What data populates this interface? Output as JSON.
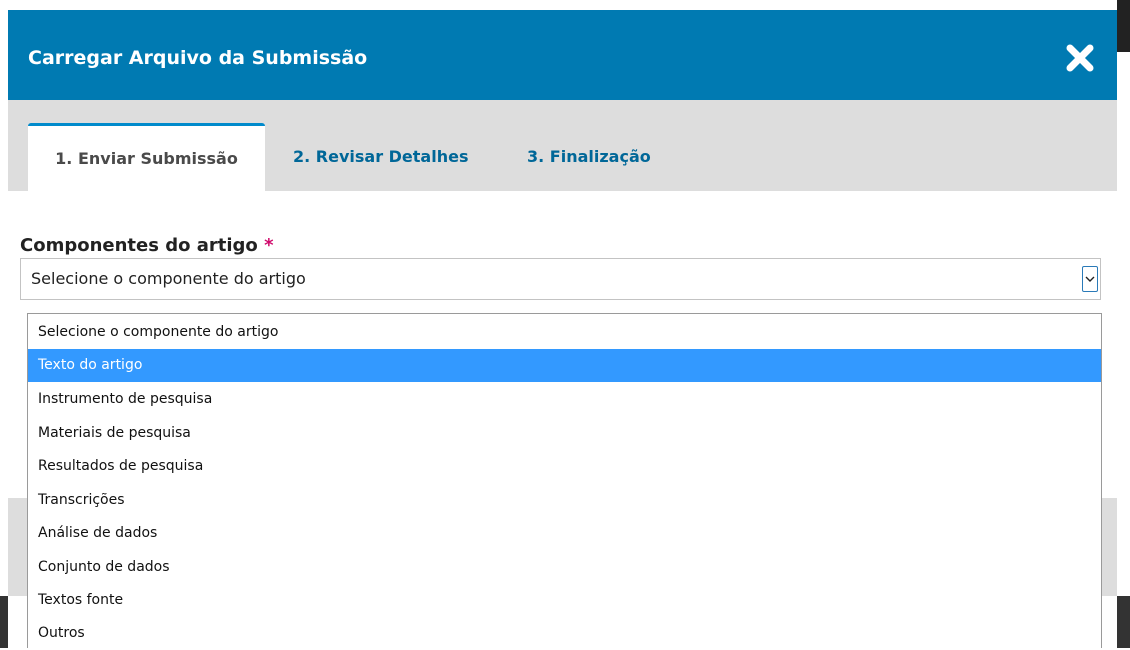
{
  "dialog": {
    "title": "Carregar Arquivo da Submissão"
  },
  "tabs": [
    {
      "label": "1. Enviar Submissão",
      "active": true
    },
    {
      "label": "2. Revisar Detalhes",
      "active": false
    },
    {
      "label": "3. Finalização",
      "active": false
    }
  ],
  "field": {
    "label": "Componentes do artigo",
    "required_mark": "*",
    "selected_value": "Selecione o componente do artigo"
  },
  "dropdown": {
    "highlighted_index": 1,
    "options": [
      "Selecione o componente do artigo",
      "Texto do artigo",
      "Instrumento de pesquisa",
      "Materiais de pesquisa",
      "Resultados de pesquisa",
      "Transcrições",
      "Análise de dados",
      "Conjunto de dados",
      "Textos fonte",
      "Outros"
    ]
  },
  "colors": {
    "header": "#007ab2",
    "tab_bar": "#dddddd",
    "link": "#006798",
    "required": "#d00a6c",
    "highlight": "#3399ff"
  },
  "icons": {
    "close": "close-icon",
    "dropdown": "chevron-down-icon"
  }
}
